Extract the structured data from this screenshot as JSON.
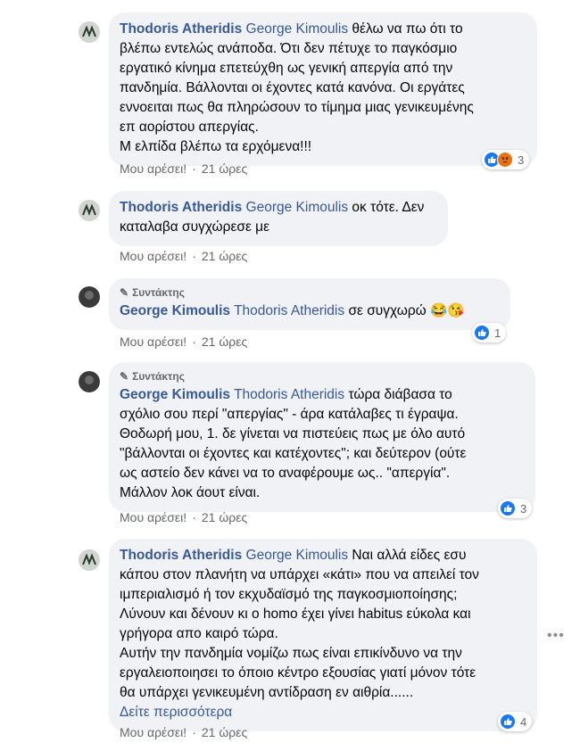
{
  "comments": [
    {
      "author": "Thodoris Atheridis",
      "mention": "George Kimoulis",
      "first_line": "θέλω να πω ότι το",
      "lines": [
        "βλέπω εντελώς ανάποδα. Ότι δεν πέτυχε το παγκόσμιο",
        "εργατικό κίνημα επετεύχθη ως γενική απεργία από την",
        "πανδημία. Βάλλονται οι έχοντες κατά κανόνα. Οι εργάτες",
        "εννοειται πως θα πληρώσουν το τίμημα μιας γενικευμένης",
        "επ αορίστου απεργίας.",
        "Μ ελπίδα βλέπω τα ερχόμενα!!!"
      ],
      "like_label": "Μου αρέσει!",
      "time": "21 ώρες",
      "reaction_count": "3"
    },
    {
      "author": "Thodoris Atheridis",
      "mention": "George Kimoulis",
      "first_line": "οκ τότε. Δεν",
      "lines": [
        "καταλαβα συγχώρεσε με"
      ],
      "like_label": "Μου αρέσει!",
      "time": "21 ώρες"
    },
    {
      "badge": "Συντάκτης",
      "author": "George Kimoulis",
      "mention": "Thodoris Atheridis",
      "first_line": "σε συγχωρώ 😂😘",
      "lines": [],
      "like_label": "Μου αρέσει!",
      "time": "21 ώρες",
      "reaction_count": "1"
    },
    {
      "badge": "Συντάκτης",
      "author": "George Kimoulis",
      "mention": "Thodoris Atheridis",
      "first_line": "τώρα διάβασα το",
      "lines": [
        "σχόλιο σου περί \"απεργίας\" - άρα κατάλαβες τι έγραψα.",
        "Θοδωρή μου, 1. δε γίνεται να πιστεύεις πως με όλο αυτό",
        "\"βάλλονται οι έχοντες και κατέχοντες\"; και δεύτερον (ούτε",
        "ως αστείο δεν κάνει να το αναφέρουμε ως.. \"απεργία\".",
        "Μάλλον λοκ άουτ είναι."
      ],
      "like_label": "Μου αρέσει!",
      "time": "21 ώρες",
      "reaction_count": "3"
    },
    {
      "author": "Thodoris Atheridis",
      "mention": "George Kimoulis",
      "first_line": "Ναι αλλά είδες εσυ",
      "lines": [
        "κάπου στον πλανήτη να υπάρχει «κάτι» που να απειλεί τον",
        "ιμπεριαλισμό ή τον εκχυδαϊσμό της παγκοσμιοποίησης;",
        "Λύνουν και δένουν κι ο homo έχει γίνει habitus εύκολα και",
        "γρήγορα απο καιρό τώρα.",
        "Αυτήν την πανδημία νομίζω πως είναι επικίνδυνο να την",
        "εργαλειοποιησει το όποιο κέντρο εξουσίας γιατί μόνον τότε",
        "θα υπάρχει γενικευμένη αντίδραση εν αιθρία......"
      ],
      "see_more": "Δείτε περισσότερα",
      "like_label": "Μου αρέσει!",
      "time": "21 ώρες",
      "reaction_count": "4"
    }
  ],
  "separator": "·",
  "more_icon": "more-horizontal-icon",
  "colors": {
    "link": "#385898",
    "bubble": "#f0f2f5",
    "meta": "#65676b",
    "like_reaction": "#1877f2"
  }
}
